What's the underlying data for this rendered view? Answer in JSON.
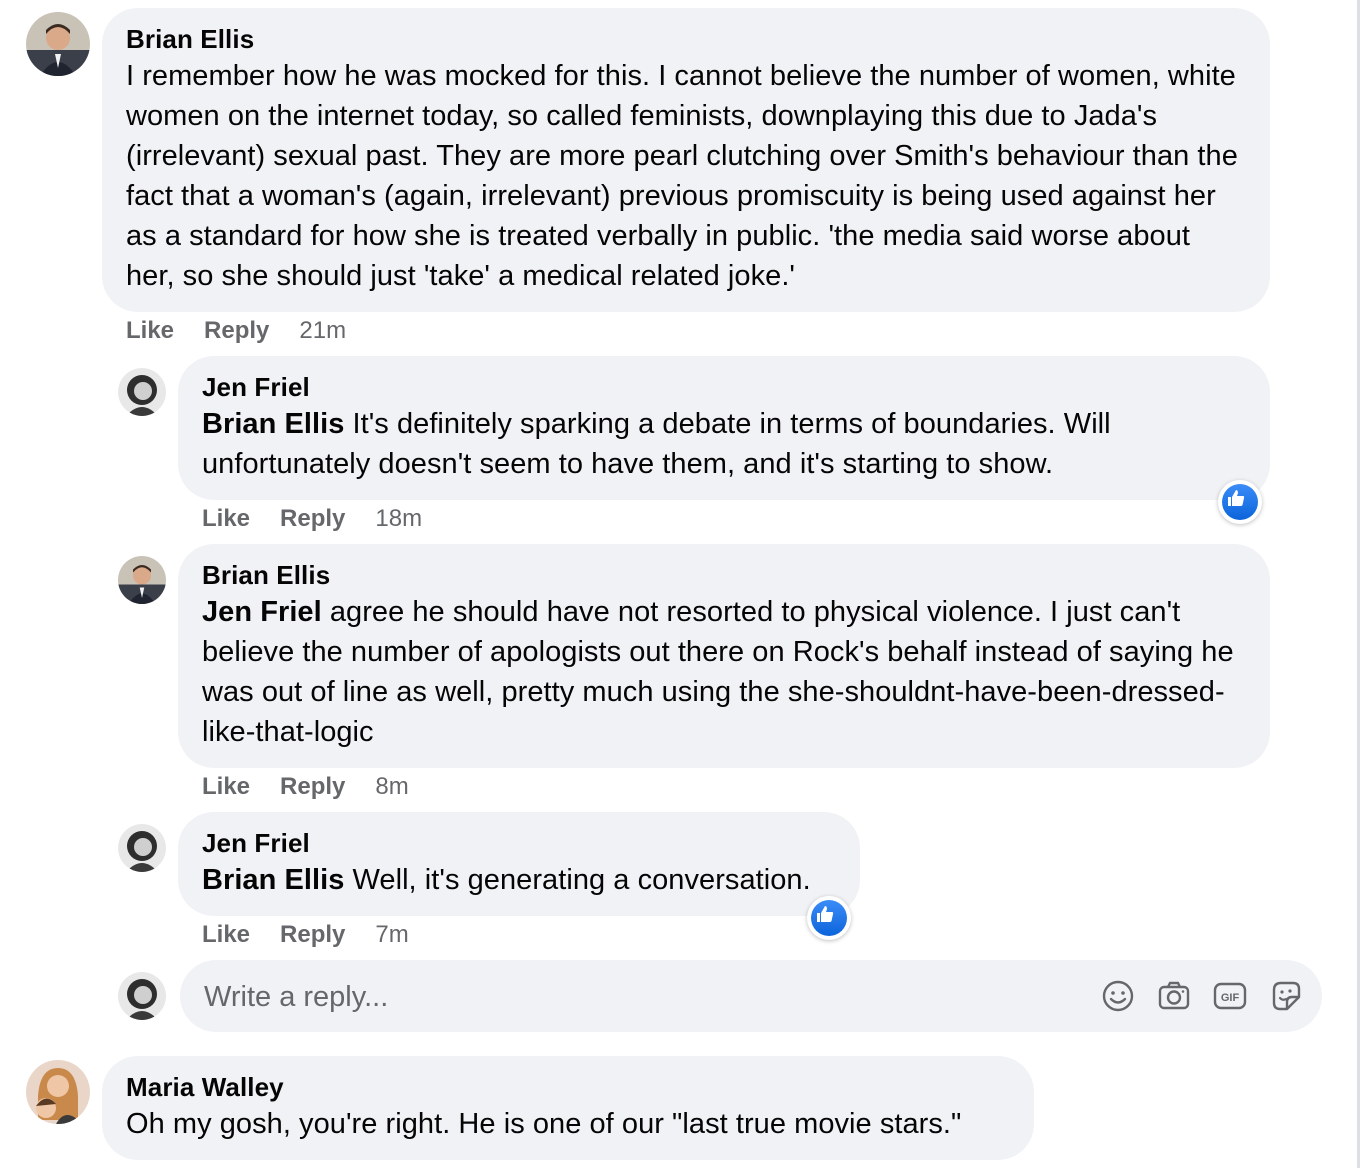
{
  "comments": [
    {
      "author": "Brian Ellis",
      "text": "I remember how he was mocked for this. I cannot believe the number of women, white women on the internet today, so called feminists, downplaying this due to Jada's (irrelevant) sexual past. They are more pearl clutching over Smith's behaviour than the fact that a woman's (again, irrelevant) previous promiscuity is being used against her as a standard for how she is treated verbally in public. 'the media said worse about her, so she should just 'take' a medical related joke.'",
      "like": "Like",
      "reply": "Reply",
      "time": "21m"
    },
    {
      "author": "Jen Friel",
      "mention": "Brian Ellis",
      "text": " It's definitely sparking a debate in terms of boundaries. Will unfortunately doesn't seem to have them, and it's starting to show.",
      "like": "Like",
      "reply": "Reply",
      "time": "18m",
      "reaction_icon": "like-reaction-icon"
    },
    {
      "author": "Brian Ellis",
      "mention": "Jen Friel",
      "text": " agree he should have not resorted to physical violence. I just can't believe the number of apologists out there on Rock's behalf instead of saying he was out of line as well, pretty much using the she-shouldnt-have-been-dressed-like-that-logic",
      "like": "Like",
      "reply": "Reply",
      "time": "8m"
    },
    {
      "author": "Jen Friel",
      "mention": "Brian Ellis",
      "text": " Well, it's generating a conversation.",
      "like": "Like",
      "reply": "Reply",
      "time": "7m",
      "reaction_icon": "like-reaction-icon"
    },
    {
      "author": "Maria Walley",
      "text": "Oh my gosh, you're right. He is one of our \"last true movie stars.\""
    }
  ],
  "reply_box": {
    "placeholder": "Write a reply...",
    "icons": [
      "emoji-icon",
      "camera-icon",
      "gif-icon",
      "sticker-icon"
    ]
  },
  "colors": {
    "bubble": "#f0f2f5",
    "meta_text": "#65676b",
    "like_blue": "#1877f2"
  }
}
